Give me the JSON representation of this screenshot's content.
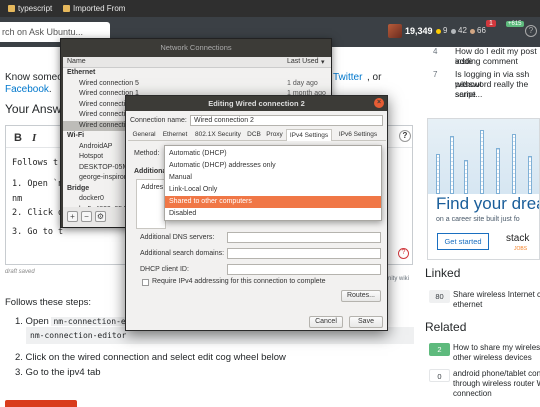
{
  "browser": {
    "bookmarks": [
      "typescript",
      "Imported From"
    ],
    "search_placeholder": "rch on Ask Ubuntu...",
    "reputation": "19,349",
    "gold": "9",
    "silver": "42",
    "bronze": "66",
    "inbox_count": "1",
    "achievements": "+615",
    "help": "?"
  },
  "page": {
    "share_prefix": "Know someor",
    "share_twitter": "Twitter",
    "share_or": ", or",
    "share_facebook": "Facebook",
    "share_dot": ".",
    "your_answer": "Your Answer",
    "bold": "B",
    "italic": "I",
    "editor_lines": [
      "Follows t",
      "1. Open `n",
      "      nm",
      "2. Click o",
      "3. Go to t"
    ],
    "tab_saved": "draft saved",
    "community_wiki": "nity wiki",
    "help_mark": "?",
    "preview_steps_intro": "Follows these steps:",
    "preview_step1_prefix": "1. Open",
    "preview_step1_code": "nm-connection-edit",
    "preview_codeblock": "nm-connection-editor",
    "preview_step2": "2. Click on the wired connection and select edit cog wheel below",
    "preview_step3": "3. Go to the ipv4 tab"
  },
  "sidebar": {
    "q4_num": "4",
    "q4_text_1": "How do I edit my post inste",
    "q4_text_2": "adding comment",
    "q7_num": "7",
    "q7_text_1": "Is logging in via ssh without",
    "q7_text_2": "password really the same",
    "q7_text_3": "script...",
    "ad_title": "Find your drea",
    "ad_sub": "on a career site built just fo",
    "ad_button": "Get started",
    "ad_logo": "stack",
    "ad_logo_sub": "JOBS",
    "linked_header": "Linked",
    "linked_votes": "80",
    "linked_text_1": "Share wireless Internet co",
    "linked_text_2": "ethernet",
    "related_header": "Related",
    "rel1_votes": "2",
    "rel1_text_1": "How to share my wireless c",
    "rel1_text_2": "other wireless devices",
    "rel2_votes": "0",
    "rel2_text_1": "android phone/tablet conne",
    "rel2_text_2": "through wireless router WI",
    "rel2_text_3": "connection"
  },
  "network_connections": {
    "title": "Network Connections",
    "col_name": "Name",
    "col_last_used": "Last Used",
    "sort_arrow": "▾",
    "rows": [
      {
        "name": "Ethernet",
        "last": "",
        "group": true
      },
      {
        "name": "Wired connection 5",
        "last": "1 day ago",
        "group": false
      },
      {
        "name": "Wired connection 1",
        "last": "1 month ago",
        "group": false
      },
      {
        "name": "Wired connection 3",
        "last": "2 months ago",
        "group": false
      },
      {
        "name": "Wired connection 4",
        "last": "2 months ago",
        "group": false
      },
      {
        "name": "Wired connection 2",
        "last": "",
        "group": false
      },
      {
        "name": "Wi-Fi",
        "last": "",
        "group": true
      },
      {
        "name": "AndroidAP",
        "last": "",
        "group": false
      },
      {
        "name": "Hotspot",
        "last": "",
        "group": false
      },
      {
        "name": "DESKTOP-05MQ",
        "last": "",
        "group": false
      },
      {
        "name": "george-inspiron",
        "last": "",
        "group": false
      },
      {
        "name": "Bridge",
        "last": "",
        "group": true
      },
      {
        "name": "docker0",
        "last": "",
        "group": false
      },
      {
        "name": "br-5e4829c054d",
        "last": "",
        "group": false
      }
    ],
    "add": "+",
    "remove": "−",
    "settings": "⚙"
  },
  "edit_dialog": {
    "title": "Editing Wired connection 2",
    "close": "×",
    "connection_name_label": "Connection name:",
    "connection_name_value": "Wired connection 2",
    "tabs": [
      "General",
      "Ethernet",
      "802.1X Security",
      "DCB",
      "Proxy",
      "IPv4 Settings",
      "IPv6 Settings"
    ],
    "method_label": "Method:",
    "additional_label": "Additiona",
    "address_label": "Addres",
    "dns_label": "Additional DNS servers:",
    "search_label": "Additional search domains:",
    "dhcp_label": "DHCP client ID:",
    "require_label": "Require IPv4 addressing for this connection to complete",
    "routes_button": "Routes...",
    "cancel_button": "Cancel",
    "save_button": "Save",
    "method_options": [
      "Automatic (DHCP)",
      "Automatic (DHCP) addresses only",
      "Manual",
      "Link-Local Only",
      "Shared to other computers",
      "Disabled"
    ],
    "selected_method": "Shared to other computers"
  },
  "colors": {
    "accent_orange": "#f07746",
    "so_blue": "#0077cc",
    "dialog_title_bg": "#3c3b37"
  }
}
